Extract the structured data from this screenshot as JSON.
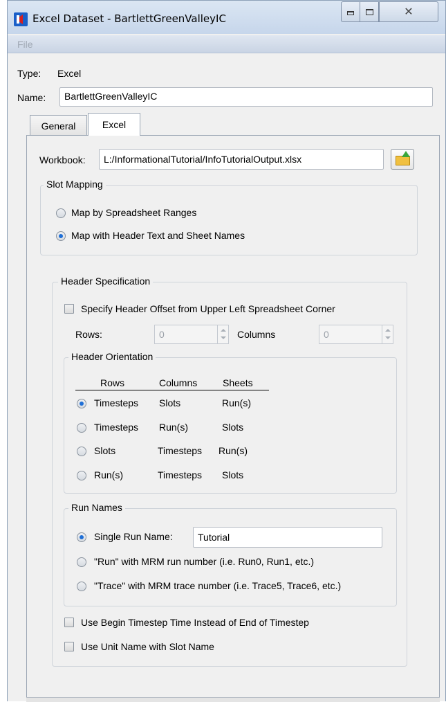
{
  "window": {
    "title": "Excel Dataset - BartlettGreenValleyIC",
    "icon": "riverware-app-icon"
  },
  "menubar": {
    "file": "File"
  },
  "type_row": {
    "label": "Type:",
    "value": "Excel"
  },
  "name_row": {
    "label": "Name:",
    "value": "BartlettGreenValleyIC"
  },
  "tabs": [
    {
      "label": "General",
      "active": false
    },
    {
      "label": "Excel",
      "active": true
    }
  ],
  "workbook": {
    "label": "Workbook:",
    "value": "L:/InformationalTutorial/InfoTutorialOutput.xlsx",
    "browse_icon": "folder-open-icon"
  },
  "slot_mapping": {
    "title": "Slot Mapping",
    "options": [
      {
        "label": "Map by Spreadsheet Ranges",
        "checked": false
      },
      {
        "label": "Map with Header Text and Sheet Names",
        "checked": true
      }
    ]
  },
  "header_spec": {
    "title": "Header Specification",
    "offset_checkbox": {
      "label": "Specify Header Offset from Upper Left Spreadsheet Corner",
      "checked": false
    },
    "rows_label": "Rows:",
    "rows_value": "0",
    "columns_label": "Columns",
    "columns_value": "0"
  },
  "header_orientation": {
    "title": "Header Orientation",
    "headings": [
      "Rows",
      "Columns",
      "Sheets"
    ],
    "options": [
      {
        "rows": "Timesteps",
        "columns": "Slots",
        "sheets": "Run(s)",
        "checked": true
      },
      {
        "rows": "Timesteps",
        "columns": "Run(s)",
        "sheets": "Slots",
        "checked": false
      },
      {
        "rows": "Slots",
        "columns": "Timesteps",
        "sheets": "Run(s)",
        "checked": false
      },
      {
        "rows": "Run(s)",
        "columns": "Timesteps",
        "sheets": "Slots",
        "checked": false
      }
    ]
  },
  "run_names": {
    "title": "Run Names",
    "single_label": "Single Run Name:",
    "single_value": "Tutorial",
    "run_label": "\"Run\" with MRM run number (i.e. Run0, Run1, etc.)",
    "trace_label": "\"Trace\" with MRM trace number (i.e. Trace5, Trace6, etc.)",
    "selected": "single"
  },
  "options": {
    "begin_timestep": {
      "label": "Use Begin Timestep Time Instead of End of Timestep",
      "checked": false
    },
    "unit_name": {
      "label": "Use Unit Name with Slot Name",
      "checked": false
    }
  }
}
